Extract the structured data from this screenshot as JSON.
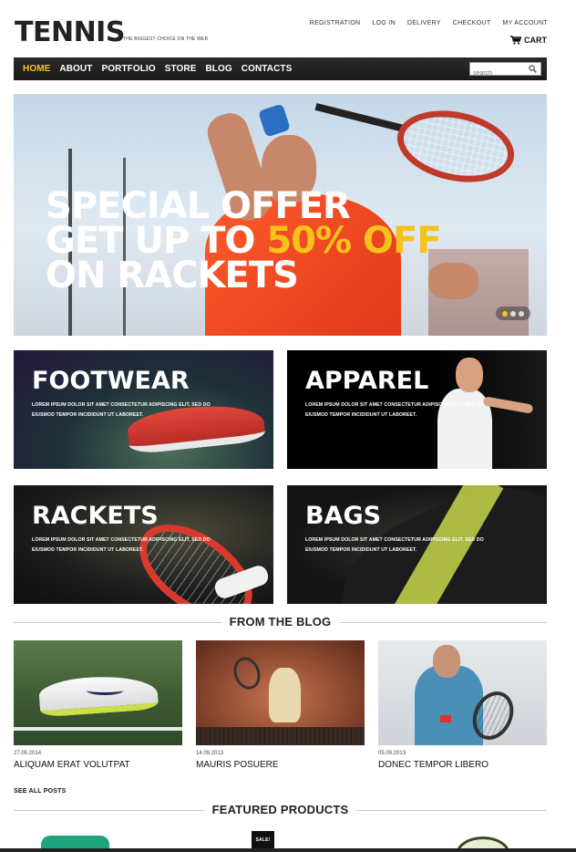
{
  "header": {
    "logo": "TENNIS",
    "tagline": "THE BIGGEST CHOICE ON THE WEB",
    "links": [
      "REGISTRATION",
      "LOG IN",
      "DELIVERY",
      "CHECKOUT",
      "MY ACCOUNT"
    ],
    "cart_label": "CART"
  },
  "nav": {
    "items": [
      "HOME",
      "ABOUT",
      "PORTFOLIO",
      "STORE",
      "BLOG",
      "CONTACTS"
    ],
    "active": "HOME",
    "search_placeholder": "search"
  },
  "hero": {
    "line1": "SPECIAL OFFER",
    "line2_prefix": "GET UP TO ",
    "line2_highlight": "50% OFF",
    "line3": "ON RACKETS",
    "highlight_color": "#f6c21b",
    "slides": 3,
    "active_slide": 1
  },
  "categories": [
    {
      "title": "FOOTWEAR",
      "text": "LOREM IPSUM DOLOR SIT AMET CONSECTETUR ADIPISCING ELIT, SED DO EIUSMOD TEMPOR INCIDIDUNT UT LABOREET."
    },
    {
      "title": "APPAREL",
      "text": "LOREM IPSUM DOLOR SIT AMET CONSECTETUR ADIPISCING ELIT, SED DO EIUSMOD TEMPOR INCIDIDUNT UT LABOREET."
    },
    {
      "title": "RACKETS",
      "text": "LOREM IPSUM DOLOR SIT AMET CONSECTETUR ADIPISCING ELIT, SED DO EIUSMOD TEMPOR INCIDIDUNT UT LABOREET."
    },
    {
      "title": "BAGS",
      "text": "LOREM IPSUM DOLOR SIT AMET CONSECTETUR ADIPISCING ELIT, SED DO EIUSMOD TEMPOR INCIDIDUNT UT LABOREET."
    }
  ],
  "blog": {
    "heading": "FROM THE BLOG",
    "posts": [
      {
        "date": "27.05.2014",
        "title": "ALIQUAM ERAT VOLUTPAT"
      },
      {
        "date": "14.09.2013",
        "title": "MAURIS POSUERE"
      },
      {
        "date": "05.09.2013",
        "title": "DONEC TEMPOR LIBERO"
      }
    ],
    "see_all": "SEE ALL POSTS"
  },
  "featured": {
    "heading": "FEATURED PRODUCTS",
    "sale_badge": "SALE!"
  },
  "colors": {
    "accent": "#f6c21b",
    "nav_bg": "#222222"
  }
}
